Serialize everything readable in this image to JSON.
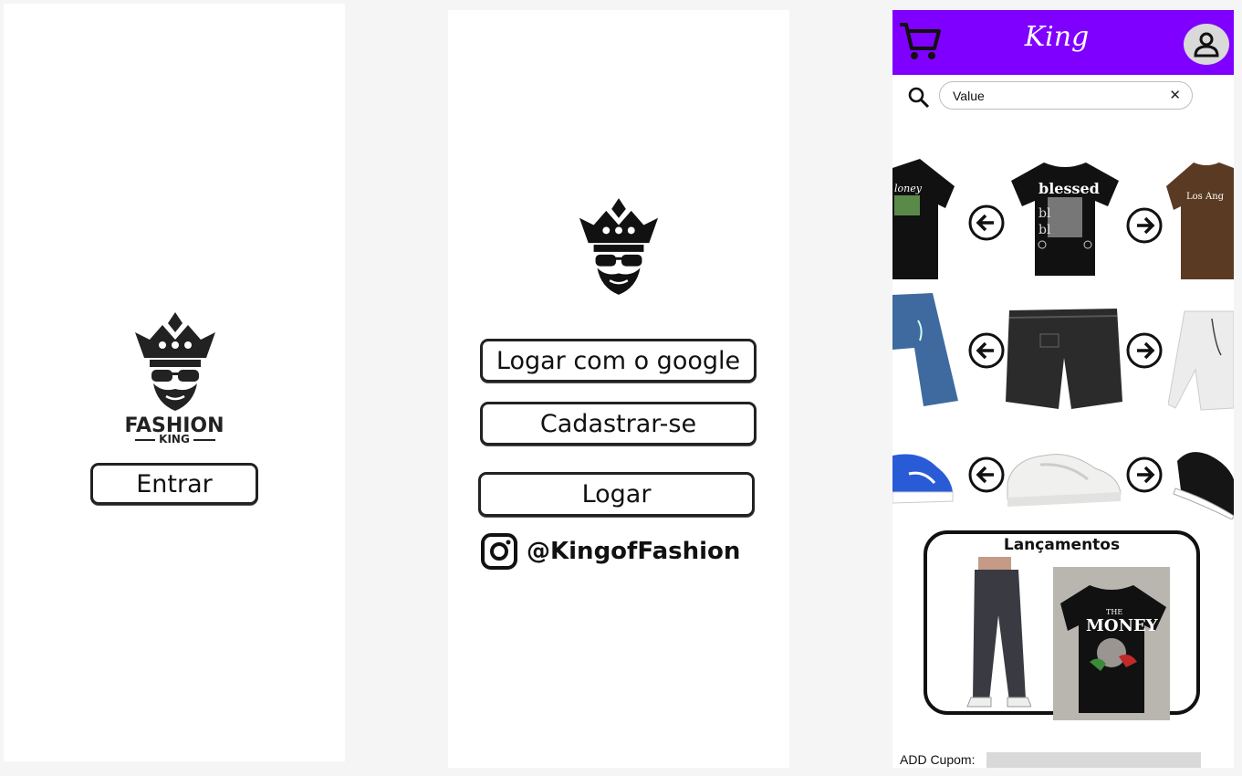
{
  "screen1": {
    "brand_main": "FASHION",
    "brand_sub": "KING",
    "enter_label": "Entrar"
  },
  "screen2": {
    "google_label": "Logar com o google",
    "signup_label": "Cadastrar-se",
    "login_label": "Logar",
    "instagram_handle": "@KingofFashion"
  },
  "screen3": {
    "header_title": "King",
    "search": {
      "value": "Value"
    },
    "launch_title": "Lançamentos",
    "coupon_label": "ADD Cupom:",
    "products": [
      {
        "row": "t-shirts",
        "left": "Money t-shirt",
        "center": "blessed t-shirt",
        "right": "Los Angeles t-shirt"
      },
      {
        "row": "shorts",
        "left": "denim shorts",
        "center": "black denim shorts",
        "right": "white shorts"
      },
      {
        "row": "sneakers",
        "left": "blue sneaker",
        "center": "white sneaker",
        "right": "black sneaker"
      }
    ],
    "launch_shirt_text": {
      "top": "THE",
      "main": "MONEY"
    }
  },
  "colors": {
    "accent": "#8000ff",
    "ink": "#111111",
    "canvas": "#f5f5f5"
  }
}
